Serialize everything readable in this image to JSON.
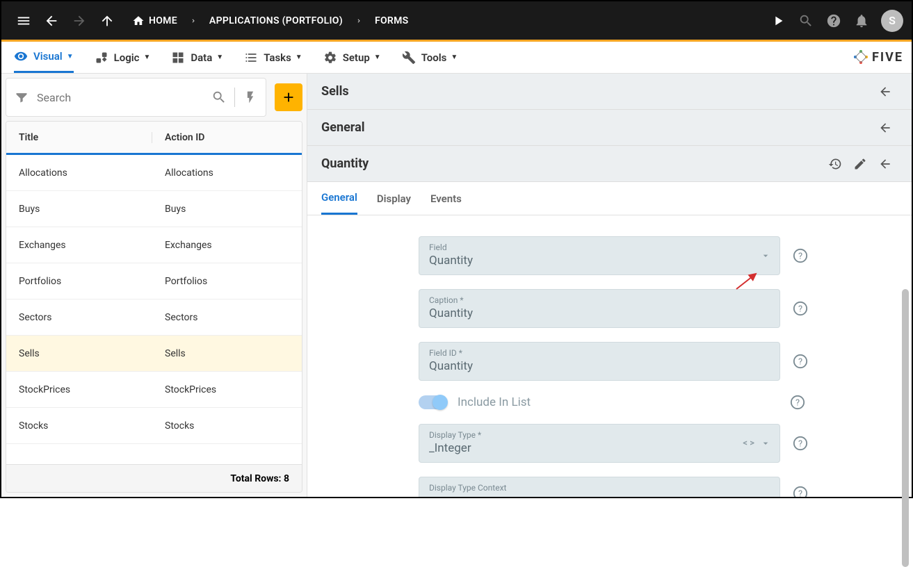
{
  "topbar": {
    "home": "HOME",
    "apps": "APPLICATIONS (PORTFOLIO)",
    "forms": "FORMS",
    "avatar": "S"
  },
  "menubar": {
    "visual": "Visual",
    "logic": "Logic",
    "data": "Data",
    "tasks": "Tasks",
    "setup": "Setup",
    "tools": "Tools",
    "logo": "FIVE"
  },
  "left": {
    "search_placeholder": "Search",
    "col_title": "Title",
    "col_action": "Action ID",
    "rows": [
      {
        "title": "Allocations",
        "action": "Allocations"
      },
      {
        "title": "Buys",
        "action": "Buys"
      },
      {
        "title": "Exchanges",
        "action": "Exchanges"
      },
      {
        "title": "Portfolios",
        "action": "Portfolios"
      },
      {
        "title": "Sectors",
        "action": "Sectors"
      },
      {
        "title": "Sells",
        "action": "Sells"
      },
      {
        "title": "StockPrices",
        "action": "StockPrices"
      },
      {
        "title": "Stocks",
        "action": "Stocks"
      }
    ],
    "footer": "Total Rows: 8"
  },
  "right": {
    "h1": "Sells",
    "h2": "General",
    "h3": "Quantity",
    "tabs": {
      "general": "General",
      "display": "Display",
      "events": "Events"
    },
    "fields": {
      "field_label": "Field",
      "field_value": "Quantity",
      "caption_label": "Caption *",
      "caption_value": "Quantity",
      "fieldid_label": "Field ID *",
      "fieldid_value": "Quantity",
      "include_label": "Include In List",
      "displaytype_label": "Display Type *",
      "displaytype_value": "_Integer",
      "context_label": "Display Type Context"
    }
  }
}
